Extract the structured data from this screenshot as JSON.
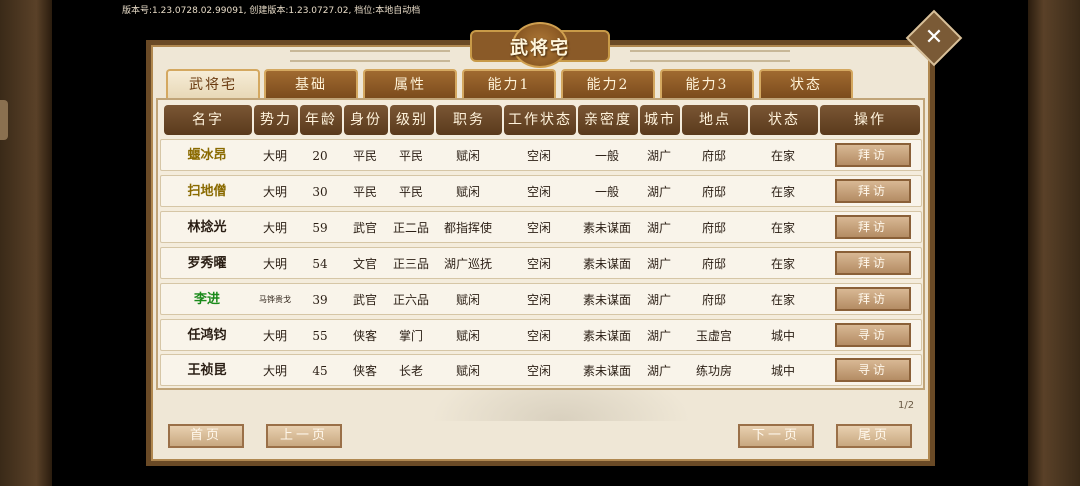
{
  "version_text": "版本号:1.23.0728.02.99091, 创建版本:1.23.0727.02, 档位:本地自动档",
  "window_title": "武将宅",
  "tabs": [
    "武将宅",
    "基础",
    "属性",
    "能力1",
    "能力2",
    "能力3",
    "状态"
  ],
  "active_tab": 0,
  "columns": [
    "名字",
    "势力",
    "年龄",
    "身份",
    "级别",
    "职务",
    "工作状态",
    "亲密度",
    "城市",
    "地点",
    "状态",
    "操作"
  ],
  "rows": [
    {
      "name": "蝘冰昂",
      "name_color": "#8a6a00",
      "faction": "大明",
      "age": "20",
      "identity": "平民",
      "rank": "平民",
      "post": "赋闲",
      "work": "空闲",
      "intimacy": "一般",
      "city": "湖广",
      "place": "府邸",
      "status": "在家",
      "action": "拜访"
    },
    {
      "name": "扫地僧",
      "name_color": "#8a6a00",
      "faction": "大明",
      "age": "30",
      "identity": "平民",
      "rank": "平民",
      "post": "赋闲",
      "work": "空闲",
      "intimacy": "一般",
      "city": "湖广",
      "place": "府邸",
      "status": "在家",
      "action": "拜访"
    },
    {
      "name": "林捻光",
      "name_color": "#2a1e14",
      "faction": "大明",
      "age": "59",
      "identity": "武官",
      "rank": "正二品",
      "post": "都指挥使",
      "work": "空闲",
      "intimacy": "素未谋面",
      "city": "湖广",
      "place": "府邸",
      "status": "在家",
      "action": "拜访"
    },
    {
      "name": "罗秀曜",
      "name_color": "#2a1e14",
      "faction": "大明",
      "age": "54",
      "identity": "文官",
      "rank": "正三品",
      "post": "湖广巡抚",
      "work": "空闲",
      "intimacy": "素未谋面",
      "city": "湖广",
      "place": "府邸",
      "status": "在家",
      "action": "拜访"
    },
    {
      "name": "李进",
      "name_color": "#1a8a1a",
      "faction": "马铧贵戈",
      "faction_small": true,
      "age": "39",
      "identity": "武官",
      "rank": "正六品",
      "post": "赋闲",
      "work": "空闲",
      "intimacy": "素未谋面",
      "city": "湖广",
      "place": "府邸",
      "status": "在家",
      "action": "拜访"
    },
    {
      "name": "任鸿钧",
      "name_color": "#2a1e14",
      "faction": "大明",
      "age": "55",
      "identity": "侠客",
      "rank": "掌门",
      "post": "赋闲",
      "work": "空闲",
      "intimacy": "素未谋面",
      "city": "湖广",
      "place": "玉虚宫",
      "status": "城中",
      "action": "寻访"
    },
    {
      "name": "王祯昆",
      "name_color": "#2a1e14",
      "faction": "大明",
      "age": "45",
      "identity": "侠客",
      "rank": "长老",
      "post": "赋闲",
      "work": "空闲",
      "intimacy": "素未谋面",
      "city": "湖广",
      "place": "练功房",
      "status": "城中",
      "action": "寻访"
    }
  ],
  "page_indicator": "1/2",
  "nav": {
    "first": "首页",
    "prev": "上一页",
    "next": "下一页",
    "last": "尾页"
  },
  "close_icon": "close-x-icon"
}
